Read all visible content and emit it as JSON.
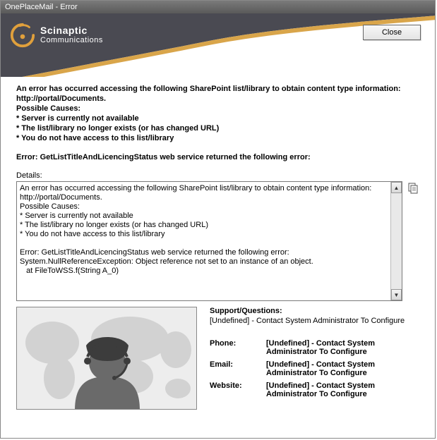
{
  "window": {
    "title": "OnePlaceMail - Error"
  },
  "brand": {
    "line1": "Scinaptic",
    "line2": "Communications"
  },
  "buttons": {
    "close": "Close"
  },
  "error": {
    "summary": "An error has occurred accessing the following SharePoint list/library to obtain content type information: http://portal/Documents.\nPossible Causes:\n* Server is currently not available\n* The list/library no longer exists (or has changed URL)\n* You do not have access to this list/library",
    "line": "Error: GetListTitleAndLicencingStatus web service returned the following error:"
  },
  "details": {
    "label": "Details:",
    "text": "An error has occurred accessing the following SharePoint list/library to obtain content type information: http://portal/Documents.\nPossible Causes:\n* Server is currently not available\n* The list/library no longer exists (or has changed URL)\n* You do not have access to this list/library\n\nError: GetListTitleAndLicencingStatus web service returned the following error:\nSystem.NullReferenceException: Object reference not set to an instance of an object.\n   at FileToWSS.f(String A_0)"
  },
  "support": {
    "heading": "Support/Questions:",
    "sub": "[Undefined] - Contact System Administrator To Configure",
    "contacts": [
      {
        "label": "Phone:",
        "value": "[Undefined] - Contact System Administrator To Configure"
      },
      {
        "label": "Email:",
        "value": "[Undefined] - Contact System Administrator To Configure"
      },
      {
        "label": "Website:",
        "value": "[Undefined] - Contact System Administrator To Configure"
      }
    ]
  }
}
